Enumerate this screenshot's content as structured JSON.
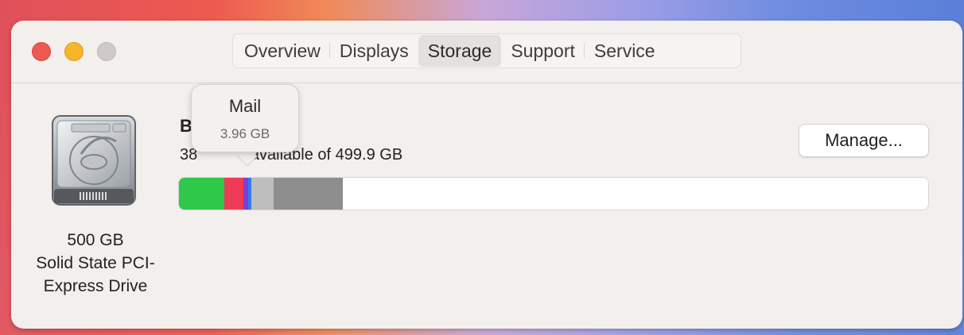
{
  "tabs": [
    {
      "label": "Overview",
      "active": false
    },
    {
      "label": "Displays",
      "active": false
    },
    {
      "label": "Storage",
      "active": true
    },
    {
      "label": "Support",
      "active": false
    },
    {
      "label": "Service",
      "active": false
    }
  ],
  "drive": {
    "icon": "internal-hard-drive-icon",
    "caption_line1": "500 GB",
    "caption_line2": "Solid State PCI-",
    "caption_line3": "Express Drive"
  },
  "volume": {
    "name": "B",
    "availability": "38            available of 499.9 GB"
  },
  "manage_button": {
    "label": "Manage..."
  },
  "storage_bar": {
    "segments": [
      {
        "name": "green",
        "fraction": 0.06,
        "color": "#2ec84a"
      },
      {
        "name": "red",
        "fraction": 0.026,
        "color": "#ee3b57"
      },
      {
        "name": "purple",
        "fraction": 0.006,
        "color": "#7e3fd0"
      },
      {
        "name": "blue",
        "fraction": 0.004,
        "color": "#2f7cf0"
      },
      {
        "name": "light-gray",
        "fraction": 0.03,
        "color": "#bebebe"
      },
      {
        "name": "dark-gray",
        "fraction": 0.092,
        "color": "#8d8d8d"
      }
    ]
  },
  "tooltip": {
    "title": "Mail",
    "size": "3.96 GB"
  },
  "colors": {
    "close": "#ee5a52",
    "minimize": "#f5b62a",
    "zoom": "#cfcac8",
    "window_bg": "#f3efed"
  }
}
